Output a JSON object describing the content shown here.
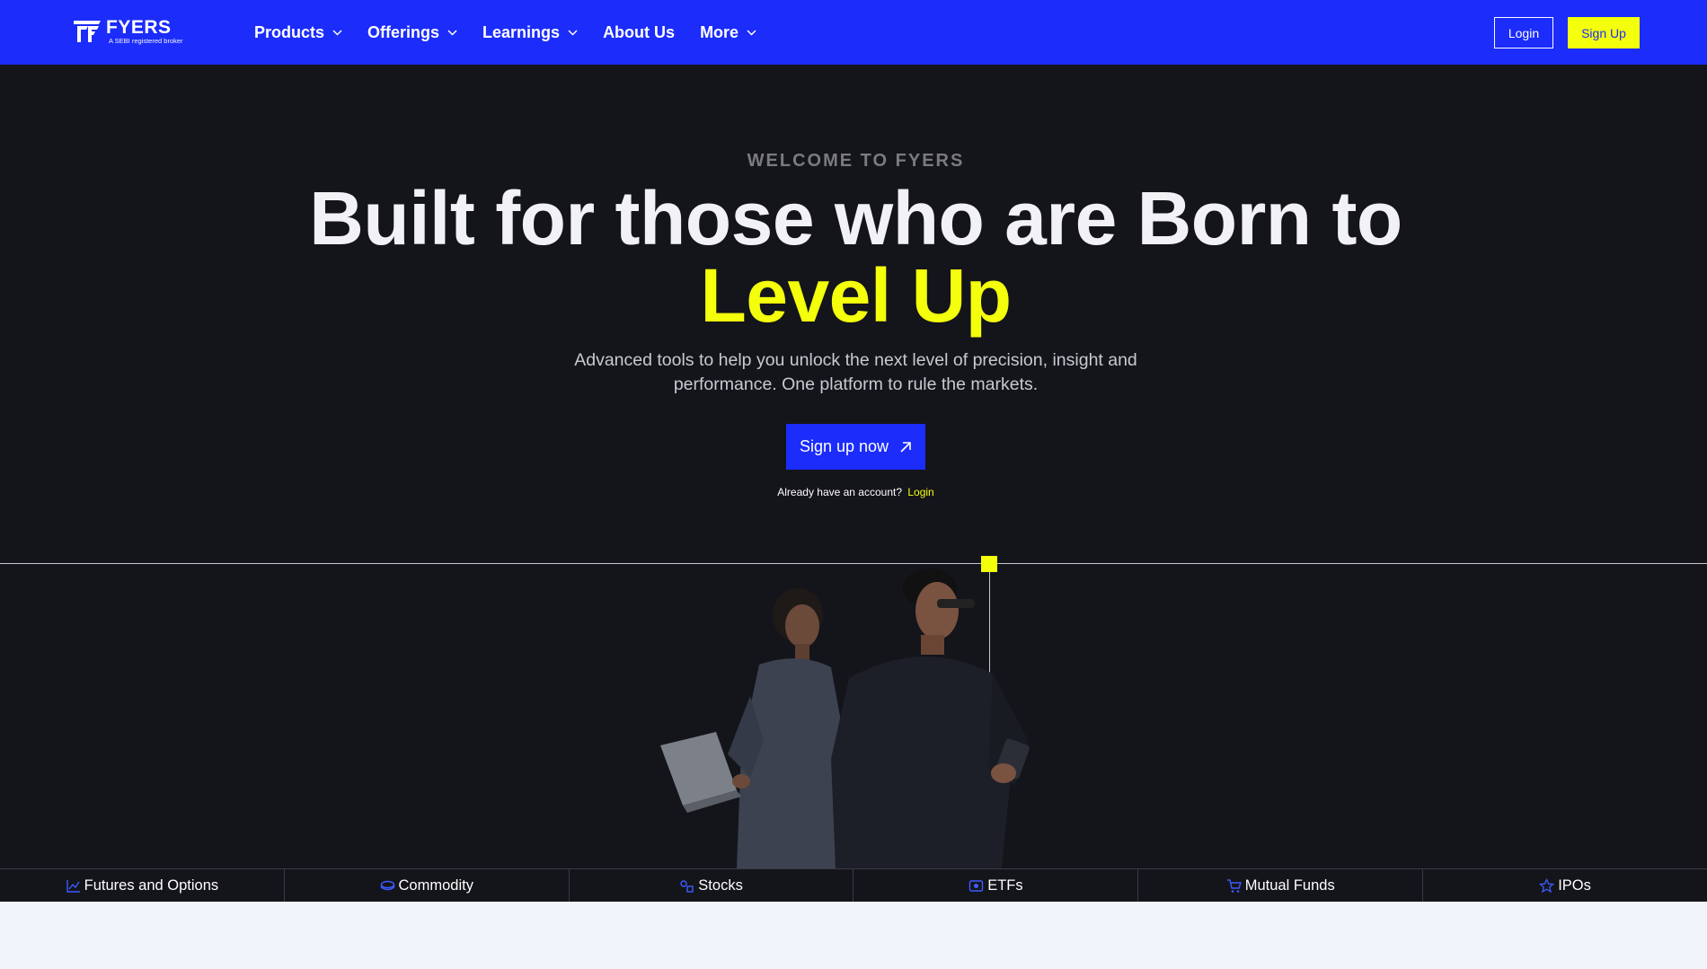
{
  "brand": {
    "name": "FYERS",
    "tagline": "A SEBI registered broker",
    "primary_color": "#1b2cfb",
    "accent_color": "#f4ff0b"
  },
  "nav": {
    "items": [
      {
        "label": "Products",
        "has_dropdown": true
      },
      {
        "label": "Offerings",
        "has_dropdown": true
      },
      {
        "label": "Learnings",
        "has_dropdown": true
      },
      {
        "label": "About Us",
        "has_dropdown": false
      },
      {
        "label": "More",
        "has_dropdown": true
      }
    ],
    "login_label": "Login",
    "signup_label": "Sign Up"
  },
  "hero": {
    "eyebrow": "WELCOME TO FYERS",
    "headline": "Built for those who are Born to",
    "headline_accent": "Level Up",
    "subtext": "Advanced tools to help you unlock the next level of precision, insight and performance. One platform to rule the markets.",
    "cta_label": "Sign up now",
    "account_prompt": "Already have an account?",
    "account_link": "Login"
  },
  "categories": [
    {
      "label": "Futures and Options",
      "icon": "chart-line-icon"
    },
    {
      "label": "Commodity",
      "icon": "coins-icon"
    },
    {
      "label": "Stocks",
      "icon": "stocks-icon"
    },
    {
      "label": "ETFs",
      "icon": "etf-icon"
    },
    {
      "label": "Mutual Funds",
      "icon": "cart-icon"
    },
    {
      "label": "IPOs",
      "icon": "star-icon"
    }
  ]
}
